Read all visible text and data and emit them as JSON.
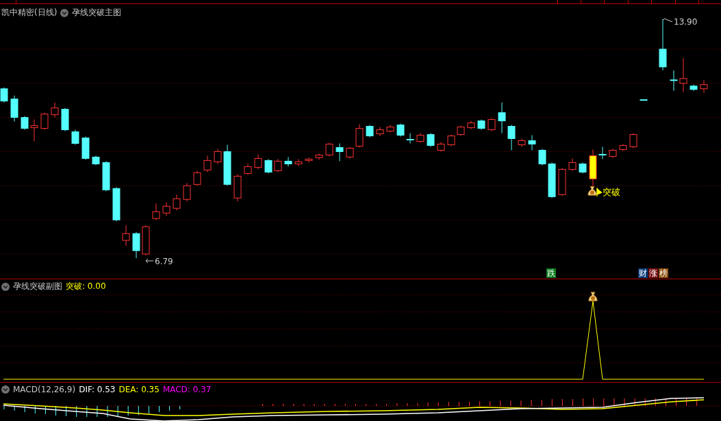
{
  "main_panel": {
    "title": "凯中精密(日线)",
    "indicator": "孕线突破主图",
    "high_label": "13.90",
    "low_label": "6.79",
    "signal_label": "突破",
    "markers": [
      {
        "text": "跌",
        "color": "#0b7a1c"
      },
      {
        "text": "财",
        "color": "#0d3c7a"
      },
      {
        "text": "涨",
        "color": "#7c1014"
      },
      {
        "text": "榜",
        "color": "#8c4c0a"
      }
    ]
  },
  "sub_panel": {
    "indicator": "孕线突破副图",
    "value_label": "突破: 0.00"
  },
  "macd_panel": {
    "title": "MACD(12,26,9)",
    "values": [
      {
        "text": "DIF: 0.53",
        "color": "#ffffff"
      },
      {
        "text": "DEA: 0.35",
        "color": "#ffff00"
      },
      {
        "text": "MACD: 0.37",
        "color": "#ff00ff"
      }
    ]
  }
}
